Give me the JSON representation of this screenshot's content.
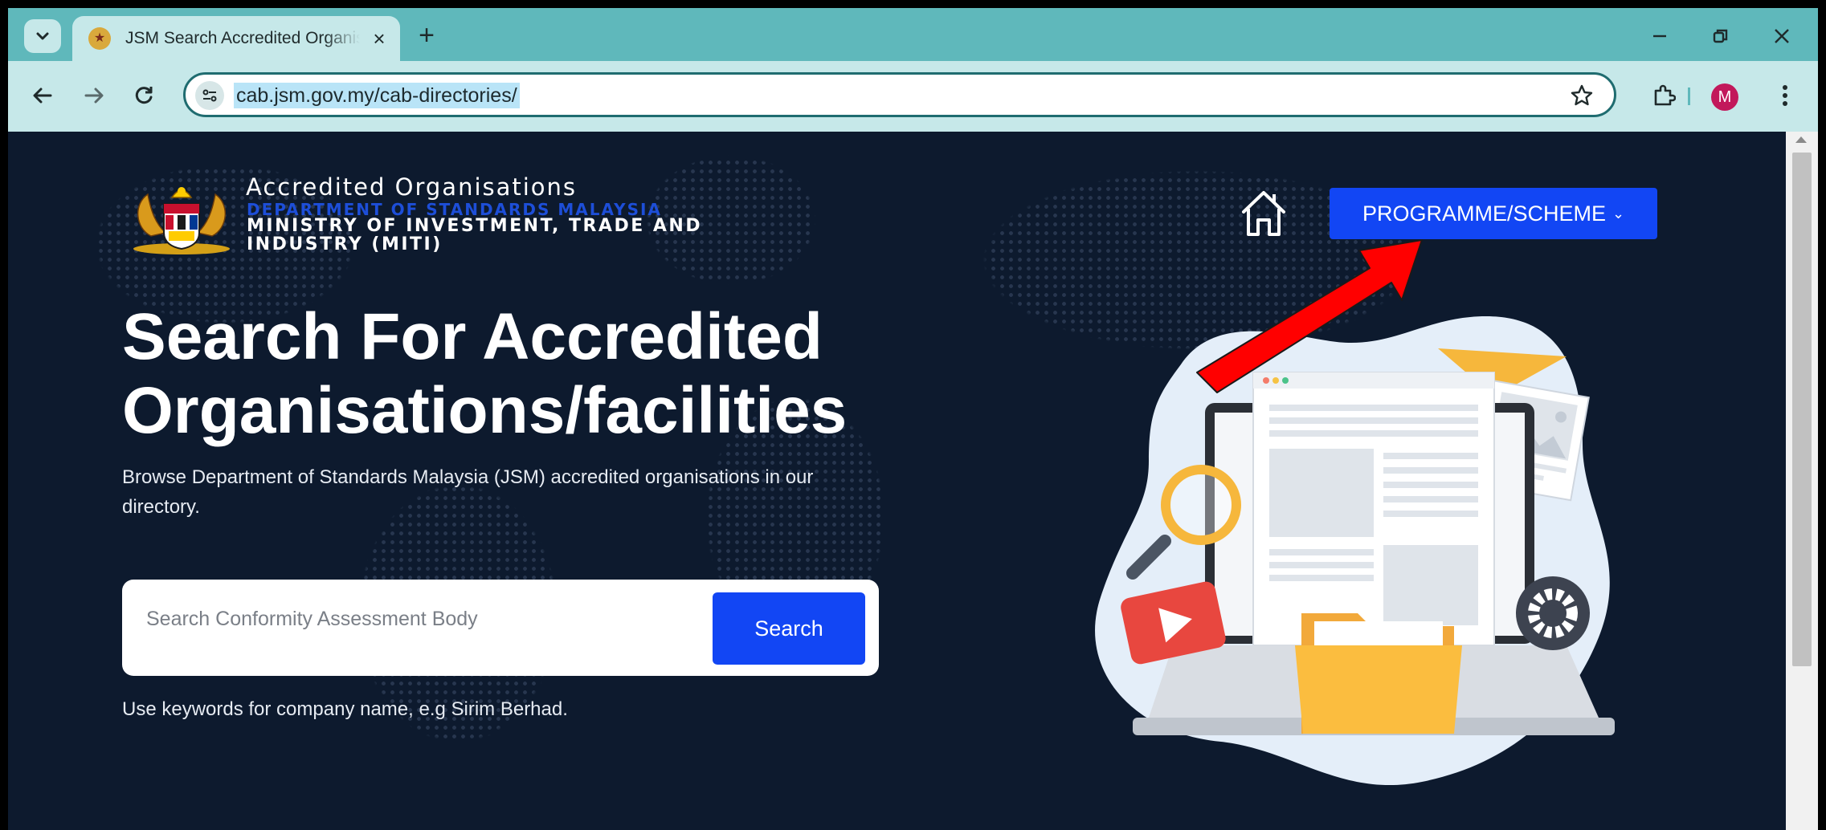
{
  "browser": {
    "tab": {
      "title": "JSM Search Accredited Organisations",
      "close_glyph": "×"
    },
    "new_tab_glyph": "+",
    "address_bar": {
      "url": "cab.jsm.gov.my/cab-directories/"
    },
    "profile_initial": "M",
    "icons": [
      "chevron-down-icon",
      "back-arrow-icon",
      "forward-arrow-icon",
      "reload-icon",
      "site-info-icon",
      "star-icon",
      "extensions-icon",
      "kebab-menu-icon",
      "minimize-icon",
      "restore-icon",
      "close-icon"
    ]
  },
  "header": {
    "brand_title": "Accredited Organisations",
    "brand_dept": "DEPARTMENT OF STANDARDS MALAYSIA",
    "brand_ministry": "MINISTRY OF INVESTMENT, TRADE AND INDUSTRY (MITI)",
    "nav": {
      "programme_label": "PROGRAMME/SCHEME",
      "programme_chevron": "⌄"
    }
  },
  "hero": {
    "title": "Search For Accredited Organisations/facilities",
    "description": "Browse Department of Standards Malaysia (JSM) accredited organisations in our directory.",
    "search": {
      "placeholder": "Search Conformity Assessment Body",
      "button_label": "Search"
    },
    "hint": "Use keywords for company name, e.g Sirim Berhad."
  },
  "colors": {
    "page_bg": "#0d1a2e",
    "accent_blue": "#1246f4",
    "chrome_teal": "#5fb8bb",
    "chrome_light": "#c6e8e9",
    "annotation_red": "#ff0000"
  }
}
